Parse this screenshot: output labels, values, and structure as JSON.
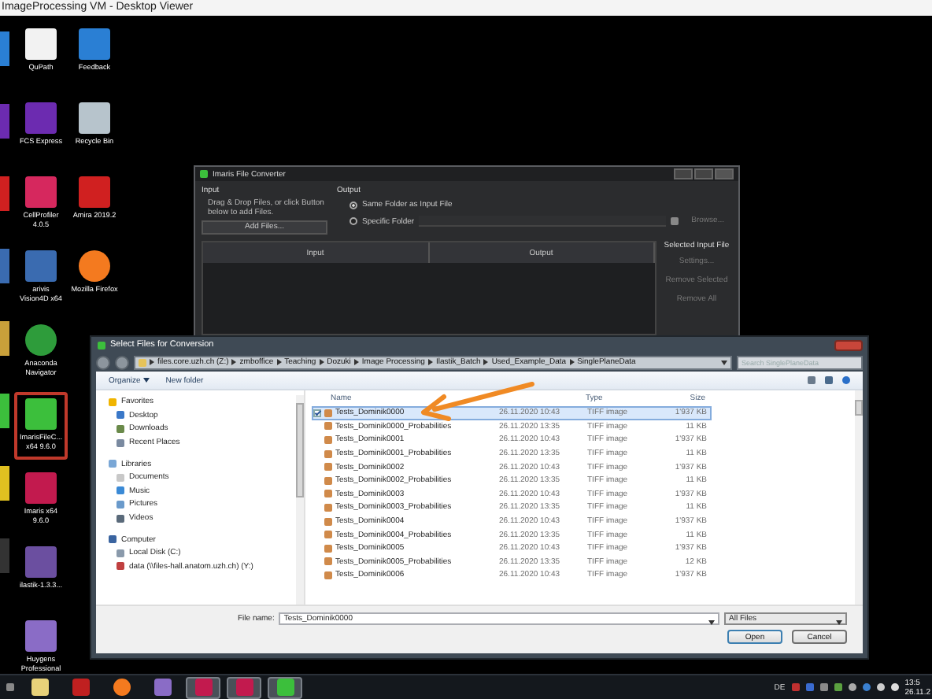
{
  "viewer": {
    "title": "ImageProcessing VM - Desktop Viewer"
  },
  "desktop": {
    "columns": [
      {
        "icons": [
          {
            "label": "QuPath",
            "kind": "doc",
            "highlighted": false
          },
          {
            "label": "FCS Express",
            "kind": "fcs",
            "highlighted": false
          },
          {
            "label": "CellProfiler 4.0.5",
            "kind": "cellprofiler",
            "highlighted": false
          },
          {
            "label": "arivis Vision4D x64",
            "kind": "arivis",
            "highlighted": false
          },
          {
            "label": "Anaconda Navigator",
            "kind": "anaconda",
            "highlighted": false
          },
          {
            "label": "ImarisFileC... x64 9.6.0",
            "kind": "converter",
            "highlighted": true
          },
          {
            "label": "Imaris x64 9.6.0",
            "kind": "imaris",
            "highlighted": false
          },
          {
            "label": "ilastik-1.3.3...",
            "kind": "ilastik",
            "highlighted": false
          },
          {
            "label": "Huygens Professional",
            "kind": "huygens",
            "highlighted": false
          }
        ]
      },
      {
        "icons": [
          {
            "label": "Feedback",
            "kind": "help",
            "highlighted": false
          },
          {
            "label": "Recycle Bin",
            "kind": "recycle",
            "highlighted": false
          },
          {
            "label": "Amira 2019.2",
            "kind": "amira",
            "highlighted": false
          },
          {
            "label": "Mozilla Firefox",
            "kind": "firefox",
            "highlighted": false
          }
        ]
      }
    ]
  },
  "converter": {
    "title": "Imaris File Converter",
    "input_heading": "Input",
    "output_heading": "Output",
    "hint": "Drag & Drop Files, or click Button below to add Files.",
    "add_button": "Add Files...",
    "output_options": [
      {
        "label": "Same Folder as Input File",
        "selected": true
      },
      {
        "label": "Specific Folder",
        "selected": false
      }
    ],
    "browse_button": "Browse...",
    "table_columns": [
      "Input",
      "Output"
    ],
    "side_heading": "Selected Input File",
    "side_buttons": [
      "Settings...",
      "Remove Selected",
      "Remove All"
    ]
  },
  "dialog": {
    "title": "Select Files for Conversion",
    "breadcrumb": [
      "files.core.uzh.ch (Z:)",
      "zmboffice",
      "Teaching",
      "Dozuki",
      "Image Processing",
      "Ilastik_Batch",
      "Used_Example_Data",
      "SinglePlaneData"
    ],
    "search": {
      "placeholder": "Search SinglePlaneData"
    },
    "toolbar": [
      "Organize",
      "New folder"
    ],
    "sidebar": [
      {
        "label": "Favorites",
        "kind": "star",
        "children": [
          {
            "label": "Desktop",
            "kind": "desktop"
          },
          {
            "label": "Downloads",
            "kind": "downloads"
          },
          {
            "label": "Recent Places",
            "kind": "recent"
          }
        ]
      },
      {
        "label": "Libraries",
        "kind": "library",
        "children": [
          {
            "label": "Documents",
            "kind": "documents"
          },
          {
            "label": "Music",
            "kind": "music"
          },
          {
            "label": "Pictures",
            "kind": "pictures"
          },
          {
            "label": "Videos",
            "kind": "videos"
          }
        ]
      },
      {
        "label": "Computer",
        "kind": "computer",
        "children": [
          {
            "label": "Local Disk (C:)",
            "kind": "disk"
          },
          {
            "label": "data (\\\\files-hall.anatom.uzh.ch) (Y:)",
            "kind": "netdrive"
          }
        ]
      }
    ],
    "columns": [
      "Name",
      "Type",
      "Size"
    ],
    "files": [
      {
        "name": "Tests_Dominik0000",
        "date": "26.11.2020 10:43",
        "type": "TIFF image",
        "size": "1'937 KB",
        "selected": true
      },
      {
        "name": "Tests_Dominik0000_Probabilities",
        "date": "26.11.2020 13:35",
        "type": "TIFF image",
        "size": "11 KB",
        "selected": false
      },
      {
        "name": "Tests_Dominik0001",
        "date": "26.11.2020 10:43",
        "type": "TIFF image",
        "size": "1'937 KB",
        "selected": false
      },
      {
        "name": "Tests_Dominik0001_Probabilities",
        "date": "26.11.2020 13:35",
        "type": "TIFF image",
        "size": "11 KB",
        "selected": false
      },
      {
        "name": "Tests_Dominik0002",
        "date": "26.11.2020 10:43",
        "type": "TIFF image",
        "size": "1'937 KB",
        "selected": false
      },
      {
        "name": "Tests_Dominik0002_Probabilities",
        "date": "26.11.2020 13:35",
        "type": "TIFF image",
        "size": "11 KB",
        "selected": false
      },
      {
        "name": "Tests_Dominik0003",
        "date": "26.11.2020 10:43",
        "type": "TIFF image",
        "size": "1'937 KB",
        "selected": false
      },
      {
        "name": "Tests_Dominik0003_Probabilities",
        "date": "26.11.2020 13:35",
        "type": "TIFF image",
        "size": "11 KB",
        "selected": false
      },
      {
        "name": "Tests_Dominik0004",
        "date": "26.11.2020 10:43",
        "type": "TIFF image",
        "size": "1'937 KB",
        "selected": false
      },
      {
        "name": "Tests_Dominik0004_Probabilities",
        "date": "26.11.2020 13:35",
        "type": "TIFF image",
        "size": "11 KB",
        "selected": false
      },
      {
        "name": "Tests_Dominik0005",
        "date": "26.11.2020 10:43",
        "type": "TIFF image",
        "size": "1'937 KB",
        "selected": false
      },
      {
        "name": "Tests_Dominik0005_Probabilities",
        "date": "26.11.2020 13:35",
        "type": "TIFF image",
        "size": "12 KB",
        "selected": false
      },
      {
        "name": "Tests_Dominik0006",
        "date": "26.11.2020 10:43",
        "type": "TIFF image",
        "size": "1'937 KB",
        "selected": false
      }
    ],
    "file_name_label": "File name:",
    "file_name": "Tests_Dominik0000",
    "filter": "All Files",
    "buttons": [
      "Open",
      "Cancel"
    ]
  },
  "taskbar": {
    "items": [
      {
        "kind": "explorer",
        "active": false
      },
      {
        "kind": "car",
        "active": false
      },
      {
        "kind": "firefox",
        "active": false
      },
      {
        "kind": "huygens",
        "active": false
      },
      {
        "kind": "imaris",
        "active": true
      },
      {
        "kind": "imaris",
        "active": true
      },
      {
        "kind": "converter",
        "active": true
      }
    ],
    "language": "DE",
    "time": "13:5",
    "date": "26.11.2"
  }
}
